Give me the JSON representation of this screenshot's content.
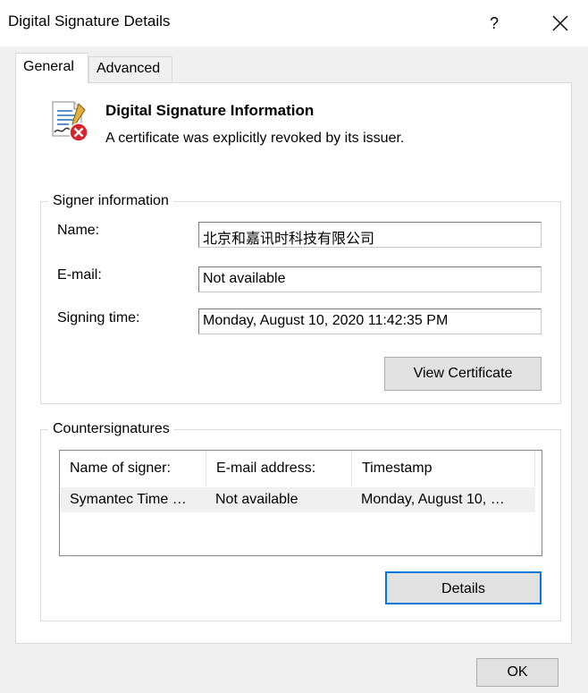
{
  "window": {
    "title": "Digital Signature Details",
    "help_label": "?",
    "close_label": "Close"
  },
  "tabs": [
    {
      "label": "General",
      "selected": true
    },
    {
      "label": "Advanced",
      "selected": false
    }
  ],
  "info": {
    "title": "Digital Signature Information",
    "status": "A certificate was explicitly revoked by its issuer."
  },
  "signer": {
    "group_label": "Signer information",
    "fields": [
      {
        "label": "Name:",
        "value": "北京和嘉讯时科技有限公司"
      },
      {
        "label": "E-mail:",
        "value": "Not available"
      },
      {
        "label": "Signing time:",
        "value": "Monday, August 10, 2020 11:42:35 PM"
      }
    ],
    "view_certificate_label": "View Certificate"
  },
  "countersignatures": {
    "group_label": "Countersignatures",
    "columns": [
      "Name of signer:",
      "E-mail address:",
      "Timestamp"
    ],
    "rows": [
      [
        "Symantec Time …",
        "Not available",
        "Monday, August 10, …"
      ]
    ],
    "details_label": "Details"
  },
  "footer": {
    "ok_label": "OK"
  },
  "colors": {
    "focus_border": "#0078d7",
    "revoked_badge": "#d9252b"
  },
  "icons": {
    "signature": "signature-document-icon",
    "revoked": "revoked-x-icon",
    "close": "close-icon"
  }
}
